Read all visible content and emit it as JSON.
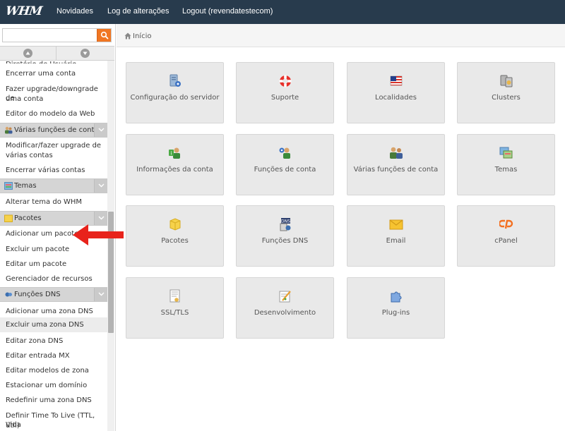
{
  "topbar": {
    "logo": "WHM",
    "nav": [
      "Novidades",
      "Log de alterações",
      "Logout (revendatestecom)"
    ]
  },
  "sidebar": {
    "search": {
      "value": "",
      "placeholder": ""
    },
    "cut_item": "Diretório de Usuário",
    "items": {
      "encerrar": "Encerrar uma conta",
      "upgrade_1": "Fazer upgrade/downgrade de",
      "upgrade_2": "uma conta",
      "editor_web": "Editor do modelo da Web",
      "modificar_1": "Modificar/fazer upgrade de",
      "modificar_2": "várias contas",
      "encerrar_varias": "Encerrar várias contas",
      "alterar_tema": "Alterar tema do WHM",
      "adicionar_pacote": "Adicionar um pacote",
      "excluir_pacote": "Excluir um pacote",
      "editar_pacote": "Editar um pacote",
      "gerenciador": "Gerenciador de recursos",
      "adicionar_zona": "Adicionar uma zona DNS",
      "excluir_zona": "Excluir uma zona DNS",
      "editar_zona": "Editar zona DNS",
      "editar_mx": "Editar entrada MX",
      "editar_modelos": "Editar modelos de zona",
      "estacionar": "Estacionar um domínio",
      "redefinir": "Redefinir uma zona DNS",
      "ttl_1": "Definir Time To Live (TTL, Vida",
      "ttl_2": "útil)"
    },
    "sections": {
      "varias": "Várias funções de conta",
      "temas": "Temas",
      "pacotes": "Pacotes",
      "dns": "Funções DNS"
    }
  },
  "breadcrumb": {
    "home": "Início"
  },
  "tiles": [
    {
      "label": "Configuração do servidor",
      "icon": "server-config-icon"
    },
    {
      "label": "Suporte",
      "icon": "lifebuoy-icon"
    },
    {
      "label": "Localidades",
      "icon": "flag-icon"
    },
    {
      "label": "Clusters",
      "icon": "clusters-icon"
    },
    {
      "label": "Informações da conta",
      "icon": "account-info-icon"
    },
    {
      "label": "Funções de conta",
      "icon": "account-functions-icon"
    },
    {
      "label": "Várias funções de conta",
      "icon": "multi-account-icon"
    },
    {
      "label": "Temas",
      "icon": "themes-icon"
    },
    {
      "label": "Pacotes",
      "icon": "package-icon"
    },
    {
      "label": "Funções DNS",
      "icon": "dns-icon"
    },
    {
      "label": "Email",
      "icon": "email-icon"
    },
    {
      "label": "cPanel",
      "icon": "cpanel-icon"
    },
    {
      "label": "SSL/TLS",
      "icon": "ssl-certificate-icon"
    },
    {
      "label": "Desenvolvimento",
      "icon": "development-icon"
    },
    {
      "label": "Plug-ins",
      "icon": "plugins-icon"
    }
  ],
  "colors": {
    "topbar": "#283b4d",
    "search_button": "#f07622",
    "annotation_arrow": "#e8231b",
    "tile_bg": "#e9e9e9"
  }
}
